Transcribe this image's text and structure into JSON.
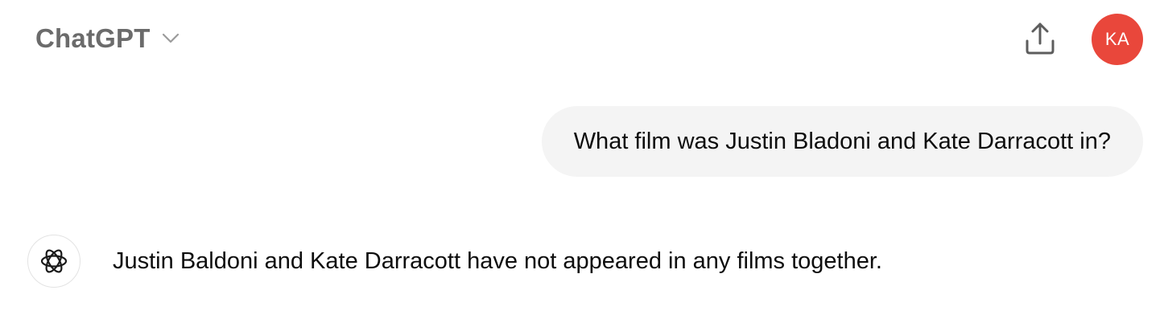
{
  "header": {
    "model_name": "ChatGPT",
    "model_dropdown_icon": "chevron-down-icon",
    "share_icon": "share-upload-icon",
    "avatar_initials": "KA",
    "avatar_color": "#e9473b"
  },
  "conversation": {
    "user_message": "What film was Justin Bladoni and Kate Darracott in?",
    "assistant_icon": "openai-logo-icon",
    "assistant_message": "Justin Baldoni and Kate Darracott have not appeared in any films together."
  }
}
